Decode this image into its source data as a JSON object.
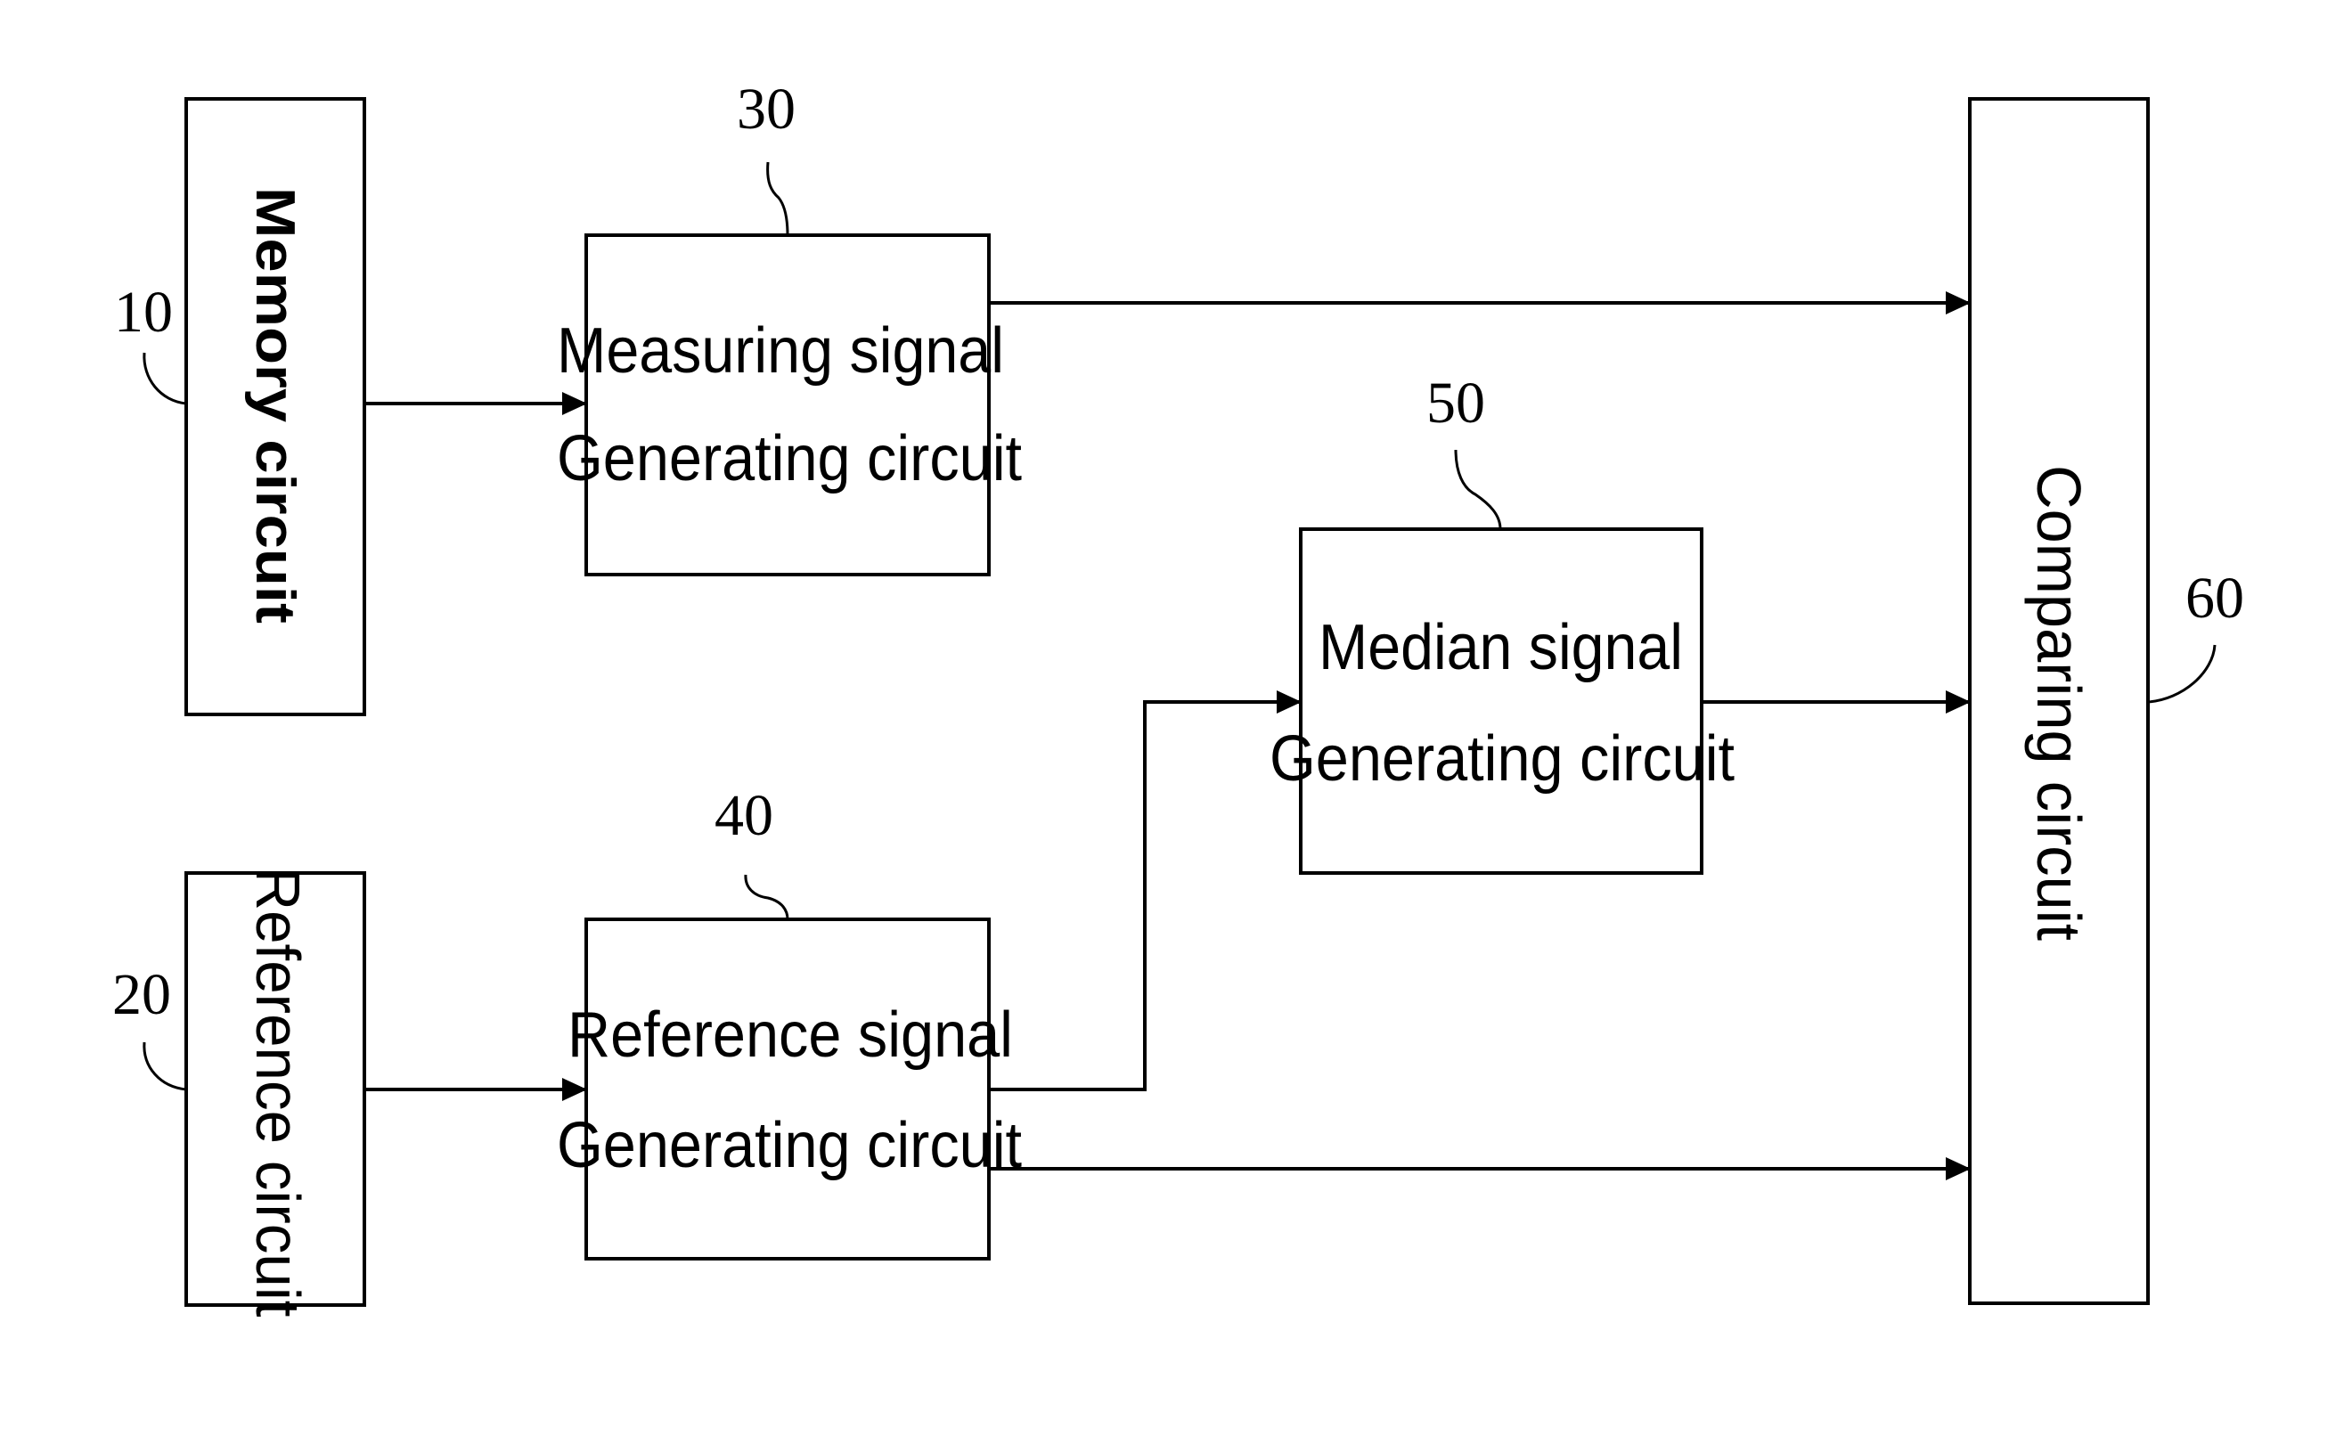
{
  "diagram": {
    "blocks": {
      "memory": {
        "ref": "10",
        "label": "Memory circuit"
      },
      "reference": {
        "ref": "20",
        "label": "Reference circuit"
      },
      "measuring": {
        "ref": "30",
        "line1": "Measuring signal",
        "line2": "Generating circuit"
      },
      "ref_signal": {
        "ref": "40",
        "line1": "Reference signal",
        "line2": "Generating circuit"
      },
      "median": {
        "ref": "50",
        "line1": "Median signal",
        "line2": "Generating circuit"
      },
      "comparing": {
        "ref": "60",
        "label": "Comparing circuit"
      }
    },
    "connections": [
      {
        "from": "Memory circuit",
        "to": "Measuring signal Generating circuit"
      },
      {
        "from": "Reference circuit",
        "to": "Reference signal Generating circuit"
      },
      {
        "from": "Measuring signal Generating circuit",
        "to": "Comparing circuit"
      },
      {
        "from": "Reference signal Generating circuit",
        "to": "Median signal Generating circuit"
      },
      {
        "from": "Median signal Generating circuit",
        "to": "Comparing circuit"
      },
      {
        "from": "Reference signal Generating circuit",
        "to": "Comparing circuit"
      }
    ]
  }
}
